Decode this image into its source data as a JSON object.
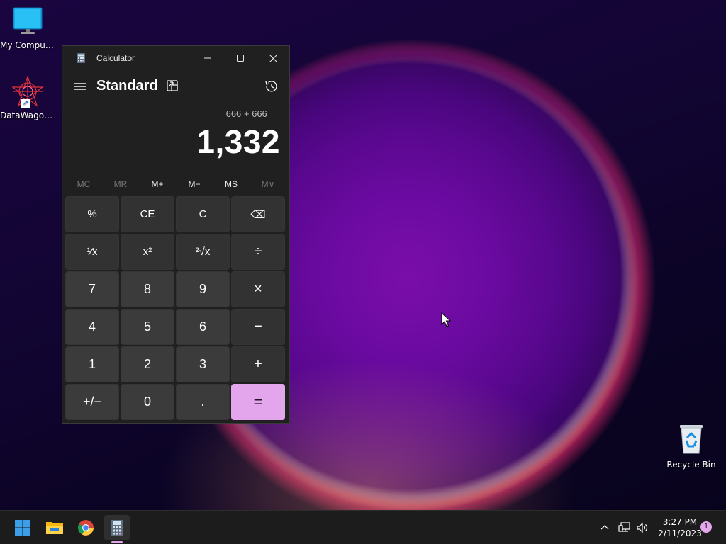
{
  "desktop": {
    "icons": [
      {
        "label": "My Computer"
      },
      {
        "label": "DataWagon..."
      },
      {
        "label": "Recycle Bin"
      }
    ]
  },
  "calculator": {
    "window_title": "Calculator",
    "mode": "Standard",
    "expression": "666 + 666 =",
    "result": "1,332",
    "memory": [
      "MC",
      "MR",
      "M+",
      "M−",
      "MS",
      "M∨"
    ],
    "keys": [
      "%",
      "CE",
      "C",
      "⌫",
      "¹⁄x",
      "x²",
      "²√x",
      "÷",
      "7",
      "8",
      "9",
      "×",
      "4",
      "5",
      "6",
      "−",
      "1",
      "2",
      "3",
      "+",
      "+/−",
      "0",
      ".",
      "="
    ],
    "accent_color": "#e3a6ec"
  },
  "taskbar": {
    "apps": [
      "start-icon",
      "file-explorer-icon",
      "chrome-icon",
      "calculator-icon"
    ],
    "clock_time": "3:27 PM",
    "clock_date": "2/11/2023",
    "notification_count": "1"
  }
}
